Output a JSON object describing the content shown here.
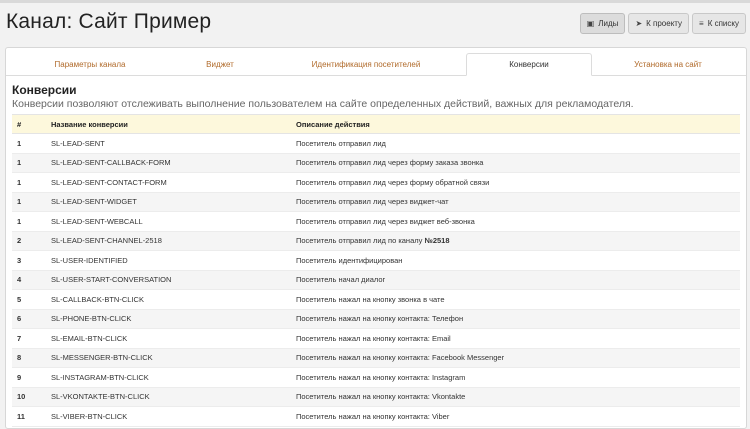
{
  "header": {
    "title": "Канал: Сайт Пример",
    "buttons": [
      {
        "label": "Лиды",
        "icon": "box-icon"
      },
      {
        "label": "К проекту",
        "icon": "rocket-icon"
      },
      {
        "label": "К списку",
        "icon": "list-icon"
      }
    ]
  },
  "tabs": [
    {
      "label": "Параметры канала",
      "active": false
    },
    {
      "label": "Виджет",
      "active": false
    },
    {
      "label": "Идентификация посетителей",
      "active": false
    },
    {
      "label": "Конверсии",
      "active": true
    },
    {
      "label": "Установка на сайт",
      "active": false
    }
  ],
  "section": {
    "title": "Конверсии",
    "description": "Конверсии позволяют отслеживать выполнение пользователем на сайте определенных действий, важных для рекламодателя."
  },
  "table": {
    "columns": [
      "#",
      "Название конверсии",
      "Описание действия"
    ],
    "rows": [
      {
        "num": "1",
        "name": "SL-LEAD-SENT",
        "desc": "Посетитель отправил лид",
        "bold": ""
      },
      {
        "num": "1",
        "name": "SL-LEAD-SENT-CALLBACK-FORM",
        "desc": "Посетитель отправил лид через форму заказа звонка",
        "bold": ""
      },
      {
        "num": "1",
        "name": "SL-LEAD-SENT-CONTACT-FORM",
        "desc": "Посетитель отправил лид через форму обратной связи",
        "bold": ""
      },
      {
        "num": "1",
        "name": "SL-LEAD-SENT-WIDGET",
        "desc": "Посетитель отправил лид через виджет-чат",
        "bold": ""
      },
      {
        "num": "1",
        "name": "SL-LEAD-SENT-WEBCALL",
        "desc": "Посетитель отправил лид через виджет веб-звонка",
        "bold": ""
      },
      {
        "num": "2",
        "name": "SL-LEAD-SENT-CHANNEL-2518",
        "desc": "Посетитель отправил лид по каналу ",
        "bold": "№2518"
      },
      {
        "num": "3",
        "name": "SL-USER-IDENTIFIED",
        "desc": "Посетитель идентифицирован",
        "bold": ""
      },
      {
        "num": "4",
        "name": "SL-USER-START-CONVERSATION",
        "desc": "Посетитель начал диалог",
        "bold": ""
      },
      {
        "num": "5",
        "name": "SL-CALLBACK-BTN-CLICK",
        "desc": "Посетитель нажал на кнопку звонка в чате",
        "bold": ""
      },
      {
        "num": "6",
        "name": "SL-PHONE-BTN-CLICK",
        "desc": "Посетитель нажал на кнопку контакта: Телефон",
        "bold": ""
      },
      {
        "num": "7",
        "name": "SL-EMAIL-BTN-CLICK",
        "desc": "Посетитель нажал на кнопку контакта: Email",
        "bold": ""
      },
      {
        "num": "8",
        "name": "SL-MESSENGER-BTN-CLICK",
        "desc": "Посетитель нажал на кнопку контакта: Facebook Messenger",
        "bold": ""
      },
      {
        "num": "9",
        "name": "SL-INSTAGRAM-BTN-CLICK",
        "desc": "Посетитель нажал на кнопку контакта: Instagram",
        "bold": ""
      },
      {
        "num": "10",
        "name": "SL-VKONTAKTE-BTN-CLICK",
        "desc": "Посетитель нажал на кнопку контакта: Vkontakte",
        "bold": ""
      },
      {
        "num": "11",
        "name": "SL-VIBER-BTN-CLICK",
        "desc": "Посетитель нажал на кнопку контакта: Viber",
        "bold": ""
      }
    ]
  }
}
